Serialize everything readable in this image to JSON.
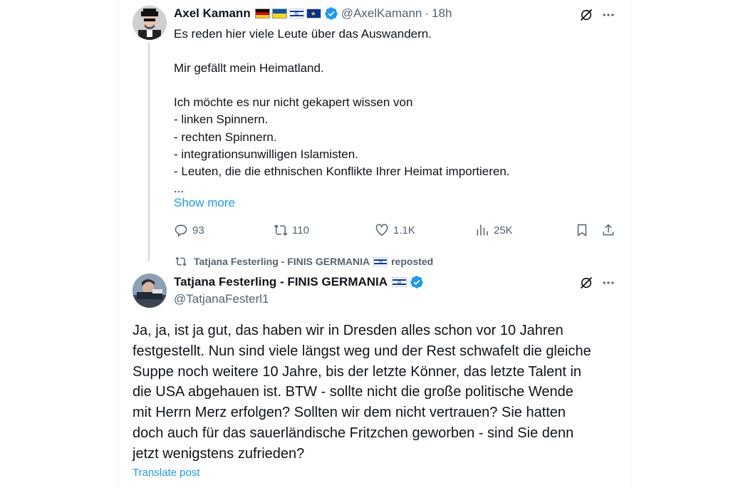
{
  "colors": {
    "accent": "#1d9bf0",
    "secondary_text": "#536471",
    "primary_text": "#0f1419"
  },
  "tweet1": {
    "display_name": "Axel Kamann",
    "flags": [
      "flag-de",
      "flag-ua",
      "flag-il",
      "flag-eu"
    ],
    "verified": true,
    "handle": "@AxelKamann",
    "separator": "·",
    "time": "18h",
    "lines": [
      "Es reden hier viele Leute über das Auswandern.",
      "",
      "Mir gefällt mein Heimatland.",
      "",
      "Ich möchte es nur nicht gekapert wissen von",
      "- linken Spinnern.",
      "- rechten Spinnern.",
      "- integrationsunwilligen Islamisten.",
      "- Leuten, die die ethnischen Konflikte Ihrer Heimat importieren.",
      "..."
    ],
    "show_more": "Show more",
    "actions": {
      "replies": "93",
      "reposts": "110",
      "likes": "1.1K",
      "views": "25K"
    }
  },
  "repost_banner": {
    "text": "Tatjana Festerling - FINIS GERMANIA",
    "suffix": "reposted",
    "flag": "flag-il"
  },
  "tweet2": {
    "display_name": "Tatjana Festerling - FINIS GERMANIA",
    "flag": "flag-il",
    "verified": true,
    "handle": "@TatjanaFesterl1",
    "lines": [
      "Ja, ja, ist ja gut, das haben wir in Dresden alles schon vor 10 Jahren",
      "festgestellt. Nun sind viele längst weg und der Rest schwafelt die gleiche",
      "Suppe noch weitere 10 Jahre, bis der letzte Könner, das letzte Talent in",
      "die USA abgehauen ist. BTW - sollte nicht die große politische Wende",
      "mit Herrn Merz erfolgen? Sollten wir dem nicht vertrauen? Sie hatten",
      "doch auch für das sauerländische Fritzchen geworben - sind Sie denn",
      "jetzt wenigstens zufrieden?"
    ],
    "translate": "Translate post"
  }
}
